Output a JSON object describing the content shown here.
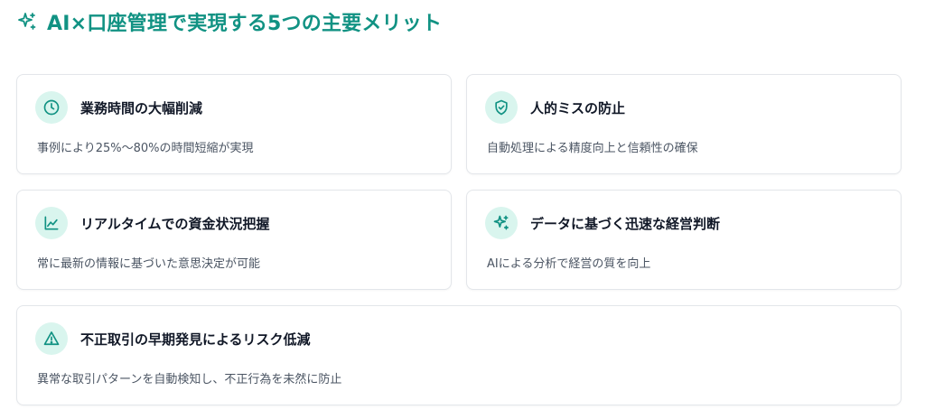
{
  "header": {
    "icon": "sparkle-icon",
    "title": "AI×口座管理で実現する5つの主要メリット",
    "accent_color": "#119283"
  },
  "cards": [
    {
      "icon": "clock-icon",
      "title": "業務時間の大幅削減",
      "description": "事例により25%～80%の時間短縮が実現"
    },
    {
      "icon": "shield-check-icon",
      "title": "人的ミスの防止",
      "description": "自動処理による精度向上と信頼性の確保"
    },
    {
      "icon": "line-chart-icon",
      "title": "リアルタイムでの資金状況把握",
      "description": "常に最新の情報に基づいた意思決定が可能"
    },
    {
      "icon": "sparkle-icon",
      "title": "データに基づく迅速な経営判断",
      "description": "AIによる分析で経営の質を向上"
    },
    {
      "icon": "warning-triangle-icon",
      "title": "不正取引の早期発見によるリスク低減",
      "description": "異常な取引パターンを自動検知し、不正行為を未然に防止"
    }
  ],
  "colors": {
    "icon_bg": "#d9f5ee",
    "icon_stroke": "#119283",
    "card_border": "#e3e6ea"
  }
}
